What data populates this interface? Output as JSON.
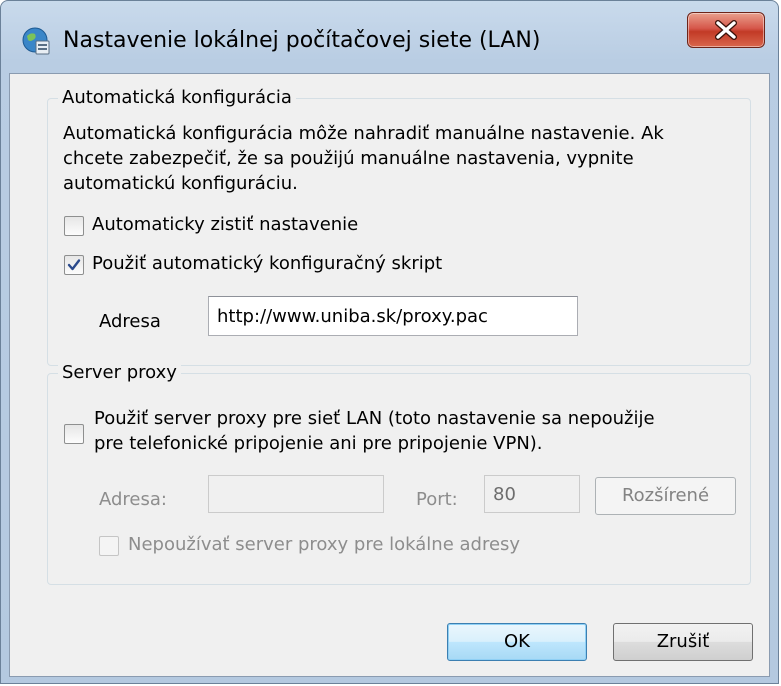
{
  "window": {
    "title": "Nastavenie lokálnej počítačovej siete (LAN)"
  },
  "auto_config": {
    "legend": "Automatická konfigurácia",
    "description_line1": "Automatická konfigurácia môže nahradiť manuálne nastavenie. Ak",
    "description_line2": "chcete zabezpečiť, že sa použijú manuálne nastavenia, vypnite",
    "description_line3": "automatickú konfiguráciu.",
    "auto_detect_label": "Automaticky zistiť nastavenie",
    "auto_detect_checked": false,
    "use_script_label": "Použiť automatický konfiguračný skript",
    "use_script_checked": true,
    "address_label": "Adresa",
    "address_value": "http://www.uniba.sk/proxy.pac"
  },
  "proxy": {
    "legend": "Server proxy",
    "use_proxy_line1": "Použiť server proxy pre sieť LAN (toto nastavenie sa nepoužije",
    "use_proxy_line2": "pre telefonické pripojenie ani pre pripojenie VPN).",
    "use_proxy_checked": false,
    "address_label": "Adresa:",
    "address_value": "",
    "port_label": "Port:",
    "port_value": "80",
    "advanced_label": "Rozšírené",
    "bypass_local_label": "Nepoužívať server proxy pre lokálne adresy",
    "bypass_local_checked": false
  },
  "buttons": {
    "ok_label": "OK",
    "cancel_label": "Zrušiť"
  }
}
